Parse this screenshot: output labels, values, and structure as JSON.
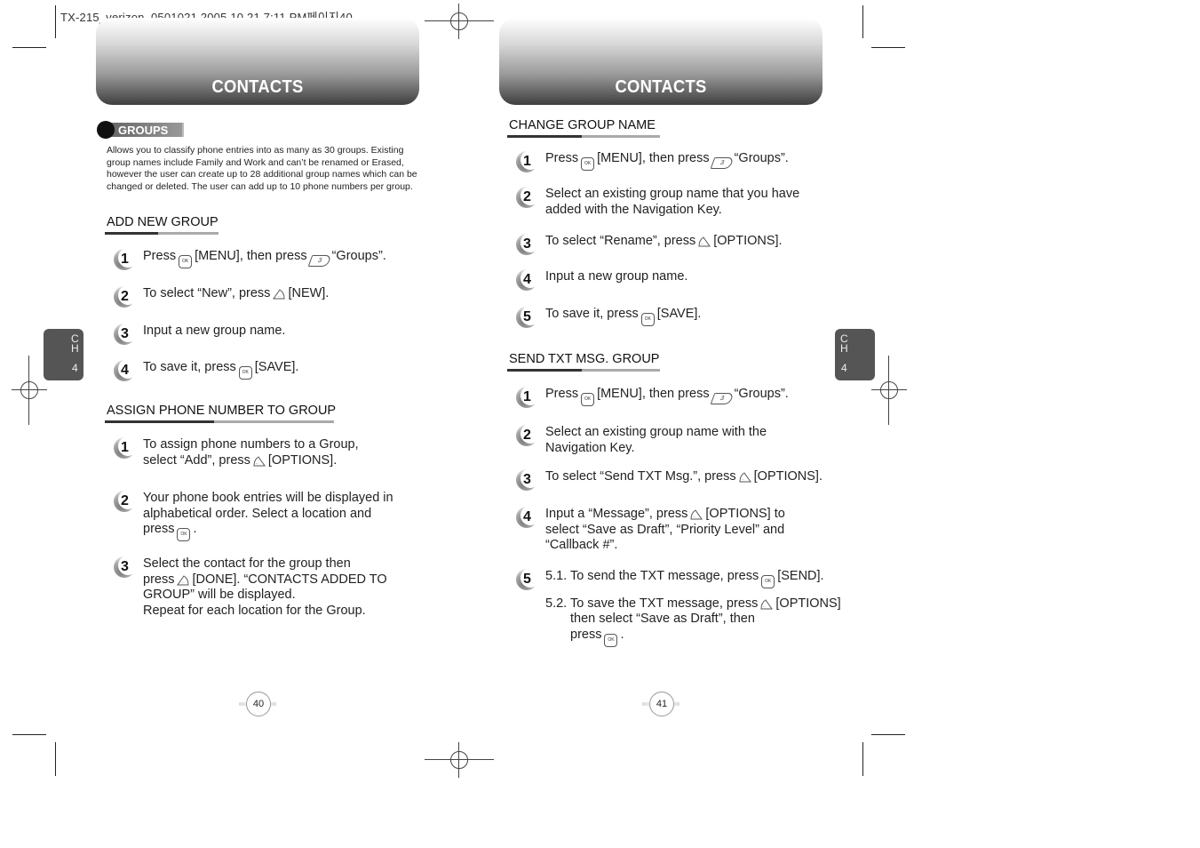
{
  "print_header": "TX-215_verizon_0501021  2005.10.21  7:11 PM페이지40",
  "pages": [
    {
      "banner_title": "CONTACTS",
      "chapter_tab": {
        "c1": "C",
        "c2": "H",
        "c3": "4"
      },
      "page_number": "40",
      "groups_badge": "GROUPS",
      "intro": "Allows you to classify phone entries into as many as 30 groups. Existing group names include Family and Work and can’t be renamed or Erased, however the user can create up to 28 additional group names which can be changed or deleted. The user can add up to 10 phone numbers per group.",
      "sections": [
        {
          "heading": "ADD NEW GROUP",
          "steps": [
            {
              "n": "1",
              "a": "Press",
              "k1": "ok-key",
              "b": "[MENU], then press",
              "k2": "3-key",
              "c": "“Groups”."
            },
            {
              "n": "2",
              "a": "To select “New”, press",
              "k1": "left-soft-key",
              "b": "[NEW]."
            },
            {
              "n": "3",
              "a": "Input a new group name."
            },
            {
              "n": "4",
              "a": "To save it, press",
              "k1": "ok-key",
              "b": "[SAVE]."
            }
          ]
        },
        {
          "heading": "ASSIGN PHONE NUMBER TO GROUP",
          "steps": [
            {
              "n": "1",
              "l1": "To assign phone numbers to a Group,",
              "l2a": "select “Add”, press",
              "k": "right-soft-key",
              "l2b": "[OPTIONS]."
            },
            {
              "n": "2",
              "l1": "Your phone book entries will be displayed in",
              "l2": "alphabetical order. Select a location and",
              "l3a": "press",
              "k": "ok-key",
              "l3b": "."
            },
            {
              "n": "3",
              "l1": "Select the contact for the group then",
              "l2a": "press",
              "k": "left-soft-key",
              "l2b": "[DONE]. “CONTACTS ADDED TO",
              "l3": "GROUP” will be displayed.",
              "l4": "Repeat for each location for the Group."
            }
          ]
        }
      ]
    },
    {
      "banner_title": "CONTACTS",
      "chapter_tab": {
        "c1": "C",
        "c2": "H",
        "c3": "4"
      },
      "page_number": "41",
      "sections": [
        {
          "heading": "CHANGE GROUP NAME",
          "steps": [
            {
              "n": "1",
              "a": "Press",
              "k1": "ok-key",
              "b": "[MENU], then press",
              "k2": "3-key",
              "c": "“Groups”."
            },
            {
              "n": "2",
              "l1": "Select an existing group name that you have",
              "l2": "added with the Navigation Key."
            },
            {
              "n": "3",
              "a": "To select “Rename”, press",
              "k1": "right-soft-key",
              "b": "[OPTIONS]."
            },
            {
              "n": "4",
              "a": "Input a new group name."
            },
            {
              "n": "5",
              "a": "To save it, press",
              "k1": "ok-key",
              "b": "[SAVE]."
            }
          ]
        },
        {
          "heading": "SEND TXT MSG. GROUP",
          "steps": [
            {
              "n": "1",
              "a": "Press",
              "k1": "ok-key",
              "b": "[MENU], then press",
              "k2": "3-key",
              "c": "“Groups”."
            },
            {
              "n": "2",
              "l1": "Select an existing group name with the",
              "l2": "Navigation Key."
            },
            {
              "n": "3",
              "a": "To select “Send TXT Msg.”, press",
              "k1": "right-soft-key",
              "b": "[OPTIONS]."
            },
            {
              "n": "4",
              "l1a": "Input a “Message”, press",
              "k": "right-soft-key",
              "l1b": "[OPTIONS] to",
              "l2": "select “Save as Draft”, “Priority Level” and",
              "l3": "“Callback #”."
            },
            {
              "n": "5",
              "s1a": "5.1. To send the TXT message, press",
              "s1k": "ok-key",
              "s1b": "[SEND].",
              "s2a": "5.2. To save the TXT message, press",
              "s2k": "right-soft-key",
              "s2b": "[OPTIONS]",
              "s2l2": "then select “Save as Draft”, then",
              "s2l3a": "press",
              "s2l3k": "ok-key",
              "s2l3b": "."
            }
          ]
        }
      ]
    }
  ]
}
